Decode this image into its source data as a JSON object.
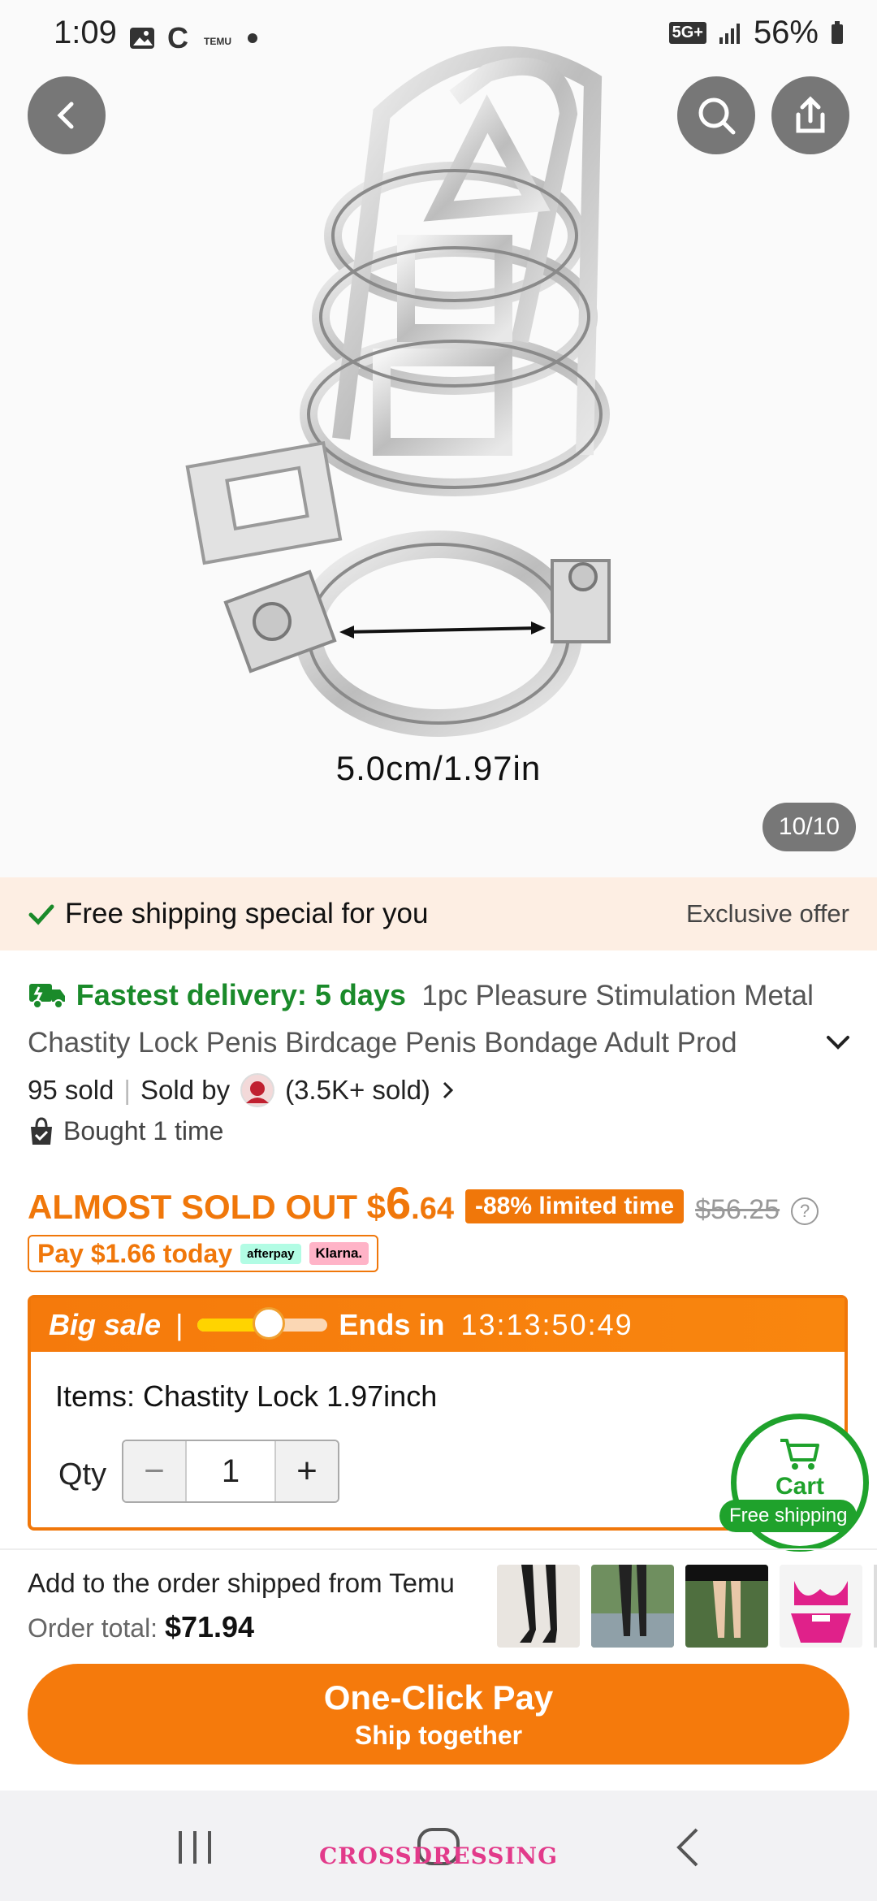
{
  "status_bar": {
    "time": "1:09",
    "network": "5G+",
    "battery": "56%"
  },
  "gallery": {
    "caption": "5.0cm/1.97in",
    "counter": "10/10"
  },
  "shipping_banner": {
    "text": "Free shipping special for you",
    "offer": "Exclusive offer"
  },
  "product": {
    "delivery": "Fastest delivery: 5 days",
    "title": "1pc Pleasure Stimulation Metal Chastity Lock Penis Birdcage Penis Bondage Adult Prod",
    "sold": "95 sold",
    "sold_by": "Sold by",
    "seller_sold": "(3.5K+ sold)",
    "bought": "Bought 1 time"
  },
  "price": {
    "almost": "ALMOST SOLD OUT",
    "currency": "$",
    "dollars": "6",
    "cents": ".64",
    "discount": "-88% limited time",
    "original": "$56.25",
    "help": "?"
  },
  "pay_today": {
    "text": "Pay $1.66 today",
    "afterpay": "afterpay",
    "klarna": "Klarna."
  },
  "sale": {
    "label": "Big sale",
    "separator": "|",
    "ends": "Ends in",
    "timer": "13:13:50:49",
    "progress": 0.55,
    "items": "Items: Chastity Lock 1.97inch",
    "qty_label": "Qty",
    "qty": "1",
    "minus": "−",
    "plus": "+"
  },
  "cart": {
    "label": "Cart",
    "free_shipping": "Free shipping"
  },
  "order": {
    "from": "Add to the order shipped from Temu",
    "total_label": "Order total:",
    "total": "$71.94"
  },
  "pay_button": {
    "line1": "One-Click Pay",
    "line2": "Ship together"
  },
  "watermark": "CROSSDRESSING",
  "colors": {
    "accent": "#f0770a",
    "green": "#1fa22c",
    "banner": "#fdeee3"
  }
}
